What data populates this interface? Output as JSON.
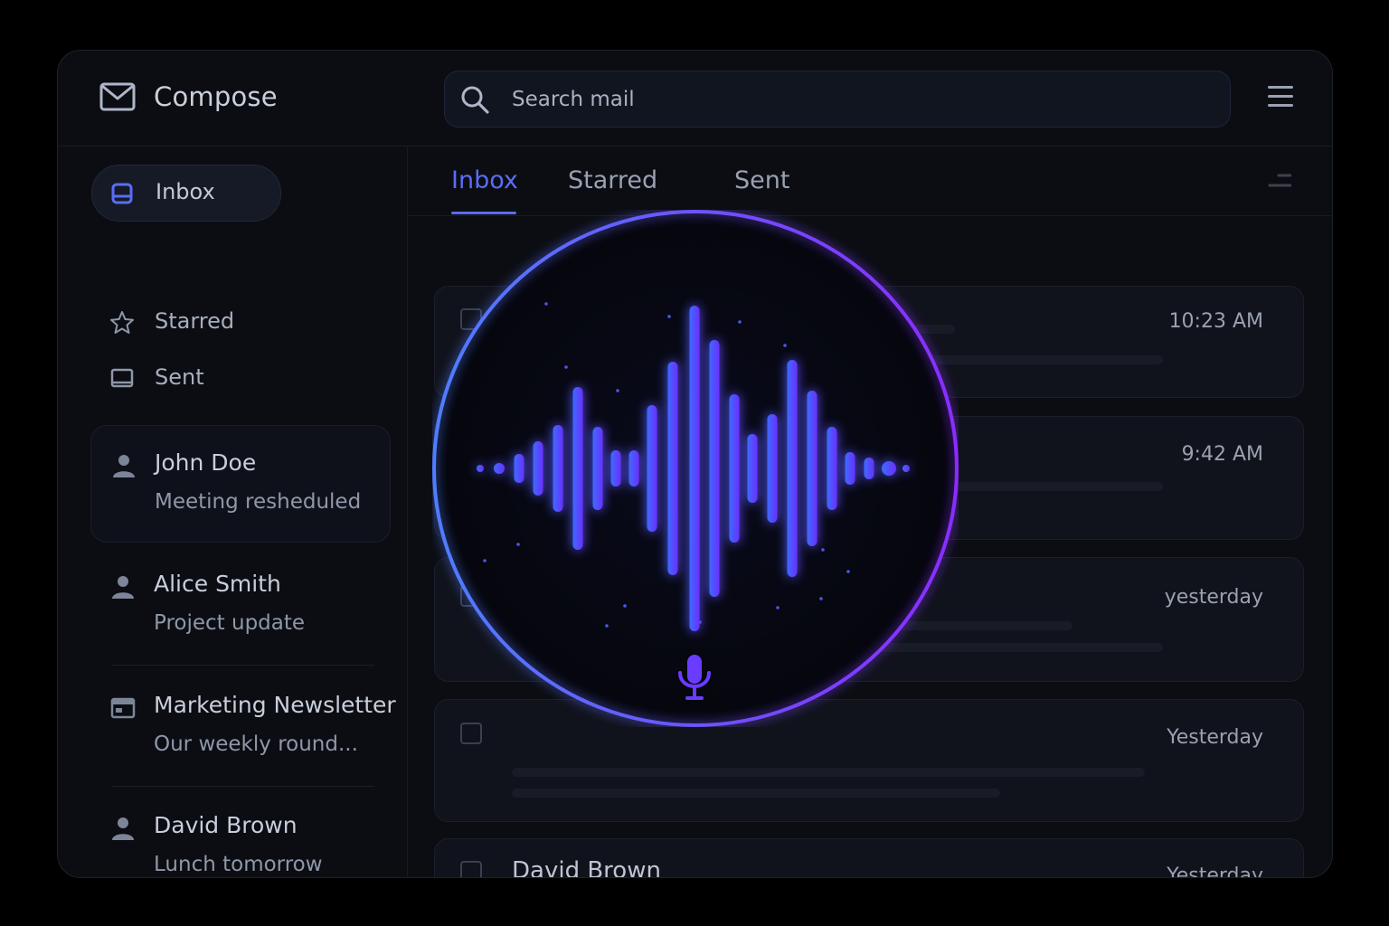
{
  "header": {
    "compose_label": "Compose",
    "search_placeholder": "Search mail"
  },
  "sidebar": {
    "nav": [
      {
        "label": "Inbox",
        "icon": "inbox-icon",
        "active": true
      },
      {
        "label": "Starred",
        "icon": "star-icon"
      },
      {
        "label": "Sent",
        "icon": "sent-icon"
      }
    ],
    "contacts": [
      {
        "name": "John Doe",
        "preview": "Meeting resheduled",
        "icon": "person-icon"
      },
      {
        "name": "Alice Smith",
        "preview": "Project update",
        "icon": "person-icon"
      },
      {
        "name": "Marketing Newsletter",
        "preview": "Our weekly round...",
        "icon": "newsletter-icon"
      },
      {
        "name": "David Brown",
        "preview": "Lunch tomorrow",
        "icon": "person-icon"
      }
    ]
  },
  "main": {
    "tabs": [
      {
        "label": "Inbox",
        "active": true
      },
      {
        "label": "Starred"
      },
      {
        "label": "Sent"
      }
    ],
    "emails": [
      {
        "time": "10:23 AM",
        "sender": ""
      },
      {
        "time": "9:42 AM",
        "sender": ""
      },
      {
        "time": "yesterday",
        "sender": ""
      },
      {
        "time": "Yesterday",
        "sender": ""
      },
      {
        "time": "Yesterday",
        "sender": "David Brown"
      }
    ]
  },
  "voice_overlay": {
    "icon": "microphone-icon",
    "accent_start": "#4f7dff",
    "accent_end": "#8a2cff"
  },
  "colors": {
    "accent": "#5b6cf5",
    "background": "#000000",
    "panel": "#0b0d13"
  }
}
